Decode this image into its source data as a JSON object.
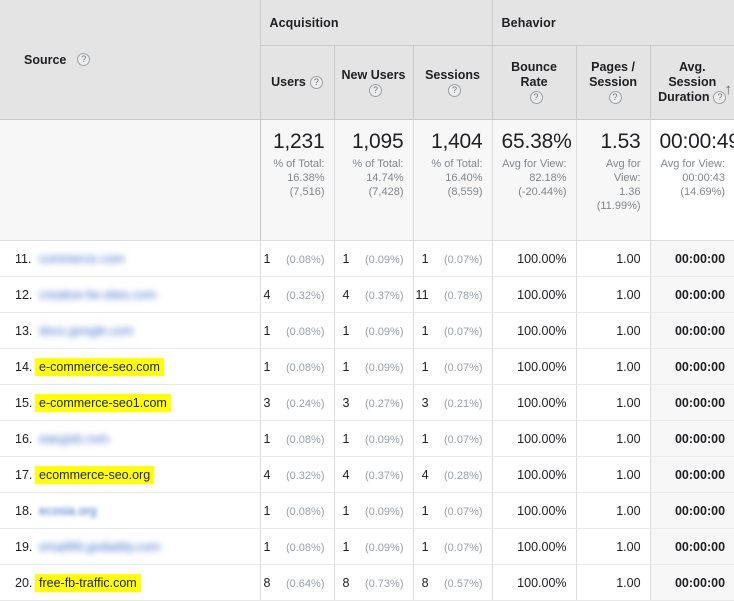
{
  "table": {
    "column_groups": [
      {
        "label": "",
        "name": "source-group"
      },
      {
        "label": "Acquisition",
        "name": "acquisition-group"
      },
      {
        "label": "Behavior",
        "name": "behavior-group"
      }
    ],
    "dimension_header": {
      "label": "Source",
      "help_icon": "?"
    },
    "columns": [
      {
        "key": "users",
        "label": "Users",
        "help_icon": "?"
      },
      {
        "key": "new_users",
        "label": "New Users",
        "help_icon": "?"
      },
      {
        "key": "sessions",
        "label": "Sessions",
        "help_icon": "?"
      },
      {
        "key": "bounce_rate",
        "label": "Bounce Rate",
        "help_icon": "?"
      },
      {
        "key": "pages_session",
        "label": "Pages / Session",
        "help_icon": "?"
      },
      {
        "key": "avg_session_duration",
        "label": "Avg. Session Duration",
        "help_icon": "?",
        "sort_icon": "↑",
        "sorted": true
      }
    ],
    "summary": {
      "users": {
        "value": "1,231",
        "line1": "% of Total:",
        "line2": "16.38%",
        "line3": "(7,516)"
      },
      "new_users": {
        "value": "1,095",
        "line1": "% of Total:",
        "line2": "14.74%",
        "line3": "(7,428)"
      },
      "sessions": {
        "value": "1,404",
        "line1": "% of Total:",
        "line2": "16.40%",
        "line3": "(8,559)"
      },
      "bounce_rate": {
        "value": "65.38%",
        "line1": "Avg for View:",
        "line2": "82.18%",
        "line3": "(-20.44%)"
      },
      "pages_session": {
        "value": "1.53",
        "line1": "Avg for",
        "line2": "View:",
        "line3": "1.36",
        "line4": "(11.99%)"
      },
      "avg_session_duration": {
        "value": "00:00:49",
        "line1": "Avg for View:",
        "line2": "00:00:43",
        "line3": "(14.69%)"
      }
    },
    "rows": [
      {
        "index": "11.",
        "source": "commerce.com",
        "redacted": true,
        "highlighted": false,
        "users": "1",
        "users_pct": "(0.08%)",
        "new_users": "1",
        "new_users_pct": "(0.09%)",
        "sessions": "1",
        "sessions_pct": "(0.07%)",
        "bounce_rate": "100.00%",
        "pages_session": "1.00",
        "avg_session_duration": "00:00:00"
      },
      {
        "index": "12.",
        "source": "creative-fw-sites.com",
        "redacted": true,
        "highlighted": false,
        "users": "4",
        "users_pct": "(0.32%)",
        "new_users": "4",
        "new_users_pct": "(0.37%)",
        "sessions": "11",
        "sessions_pct": "(0.78%)",
        "bounce_rate": "100.00%",
        "pages_session": "1.00",
        "avg_session_duration": "00:00:00"
      },
      {
        "index": "13.",
        "source": "docs.google.com",
        "redacted": true,
        "highlighted": false,
        "users": "1",
        "users_pct": "(0.08%)",
        "new_users": "1",
        "new_users_pct": "(0.09%)",
        "sessions": "1",
        "sessions_pct": "(0.07%)",
        "bounce_rate": "100.00%",
        "pages_session": "1.00",
        "avg_session_duration": "00:00:00"
      },
      {
        "index": "14.",
        "source": "e-commerce-seo.com",
        "redacted": false,
        "highlighted": true,
        "users": "1",
        "users_pct": "(0.08%)",
        "new_users": "1",
        "new_users_pct": "(0.09%)",
        "sessions": "1",
        "sessions_pct": "(0.07%)",
        "bounce_rate": "100.00%",
        "pages_session": "1.00",
        "avg_session_duration": "00:00:00"
      },
      {
        "index": "15.",
        "source": "e-commerce-seo1.com",
        "redacted": false,
        "highlighted": true,
        "users": "3",
        "users_pct": "(0.24%)",
        "new_users": "3",
        "new_users_pct": "(0.27%)",
        "sessions": "3",
        "sessions_pct": "(0.21%)",
        "bounce_rate": "100.00%",
        "pages_session": "1.00",
        "avg_session_duration": "00:00:00"
      },
      {
        "index": "16.",
        "source": "easyjob.com",
        "redacted": true,
        "highlighted": false,
        "users": "1",
        "users_pct": "(0.08%)",
        "new_users": "1",
        "new_users_pct": "(0.09%)",
        "sessions": "1",
        "sessions_pct": "(0.07%)",
        "bounce_rate": "100.00%",
        "pages_session": "1.00",
        "avg_session_duration": "00:00:00"
      },
      {
        "index": "17.",
        "source": "ecommerce-seo.org",
        "redacted": false,
        "highlighted": true,
        "users": "4",
        "users_pct": "(0.32%)",
        "new_users": "4",
        "new_users_pct": "(0.37%)",
        "sessions": "4",
        "sessions_pct": "(0.28%)",
        "bounce_rate": "100.00%",
        "pages_session": "1.00",
        "avg_session_duration": "00:00:00"
      },
      {
        "index": "18.",
        "source": "ecosia.org",
        "redacted": "light",
        "highlighted": false,
        "users": "1",
        "users_pct": "(0.08%)",
        "new_users": "1",
        "new_users_pct": "(0.09%)",
        "sessions": "1",
        "sessions_pct": "(0.07%)",
        "bounce_rate": "100.00%",
        "pages_session": "1.00",
        "avg_session_duration": "00:00:00"
      },
      {
        "index": "19.",
        "source": "email99.godaddy.com",
        "redacted": true,
        "highlighted": false,
        "users": "1",
        "users_pct": "(0.08%)",
        "new_users": "1",
        "new_users_pct": "(0.09%)",
        "sessions": "1",
        "sessions_pct": "(0.07%)",
        "bounce_rate": "100.00%",
        "pages_session": "1.00",
        "avg_session_duration": "00:00:00"
      },
      {
        "index": "20.",
        "source": "free-fb-traffic.com",
        "redacted": false,
        "highlighted": true,
        "users": "8",
        "users_pct": "(0.64%)",
        "new_users": "8",
        "new_users_pct": "(0.73%)",
        "sessions": "8",
        "sessions_pct": "(0.57%)",
        "bounce_rate": "100.00%",
        "pages_session": "1.00",
        "avg_session_duration": "00:00:00"
      }
    ]
  },
  "colors": {
    "link": "#1155cc",
    "highlight": "#ffff00",
    "header_bg": "#e4e4e4",
    "summary_bg": "#f7f7f7",
    "sorted_col_bg": "#f7f7f7"
  }
}
